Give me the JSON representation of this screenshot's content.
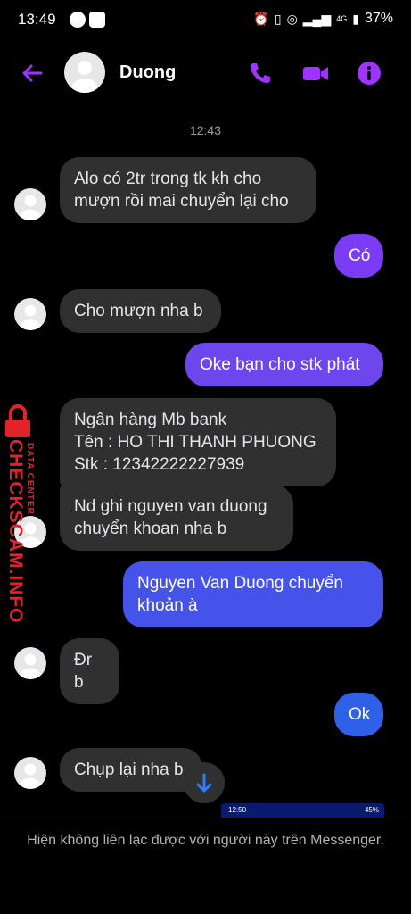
{
  "status": {
    "time": "13:49",
    "network": "4G",
    "battery": "37%",
    "colors": {
      "text": "#ffffff"
    }
  },
  "header": {
    "contact_name": "Duong",
    "icons": [
      "back-arrow-icon",
      "phone-icon",
      "video-camera-icon",
      "info-icon"
    ],
    "accent": "#a033ff"
  },
  "timestamp": "12:43",
  "messages": [
    {
      "from": "them",
      "lines": [
        "Alo có 2tr trong tk kh cho",
        "mượn rồi mai chuyển lại cho"
      ]
    },
    {
      "from": "me",
      "lines": [
        "Có"
      ]
    },
    {
      "from": "them",
      "lines": [
        "Cho mượn nha b"
      ]
    },
    {
      "from": "me",
      "lines": [
        "Oke bạn cho stk phát"
      ]
    },
    {
      "from": "them",
      "lines": [
        "Ngân hàng Mb bank",
        "Tên : HO THI THANH PHUONG",
        "Stk : 12342222227939"
      ]
    },
    {
      "from": "them",
      "lines": [
        "Nd ghi nguyen van duong",
        "chuyển khoan nha b"
      ]
    },
    {
      "from": "me",
      "lines": [
        "Nguyen Van Duong chuyển",
        "khoản à"
      ]
    },
    {
      "from": "them",
      "lines": [
        "Đr b"
      ]
    },
    {
      "from": "me",
      "lines": [
        "Ok"
      ]
    },
    {
      "from": "them",
      "lines": [
        "Chụp lại nha b"
      ]
    }
  ],
  "watermark": {
    "brand": "CHECKSCAM.INFO",
    "tagline": "DATA CENTER",
    "color": "#e2232a"
  },
  "thumbnail": {
    "time": "12:50",
    "battery": "45%"
  },
  "footer": {
    "notice": "Hiện không liên lạc được với người này trên Messenger."
  },
  "colors": {
    "incoming_bubble": "#303030",
    "outgoing_purple": "#7b3cf5",
    "outgoing_blue": "#2f60e8",
    "background": "#000000"
  }
}
